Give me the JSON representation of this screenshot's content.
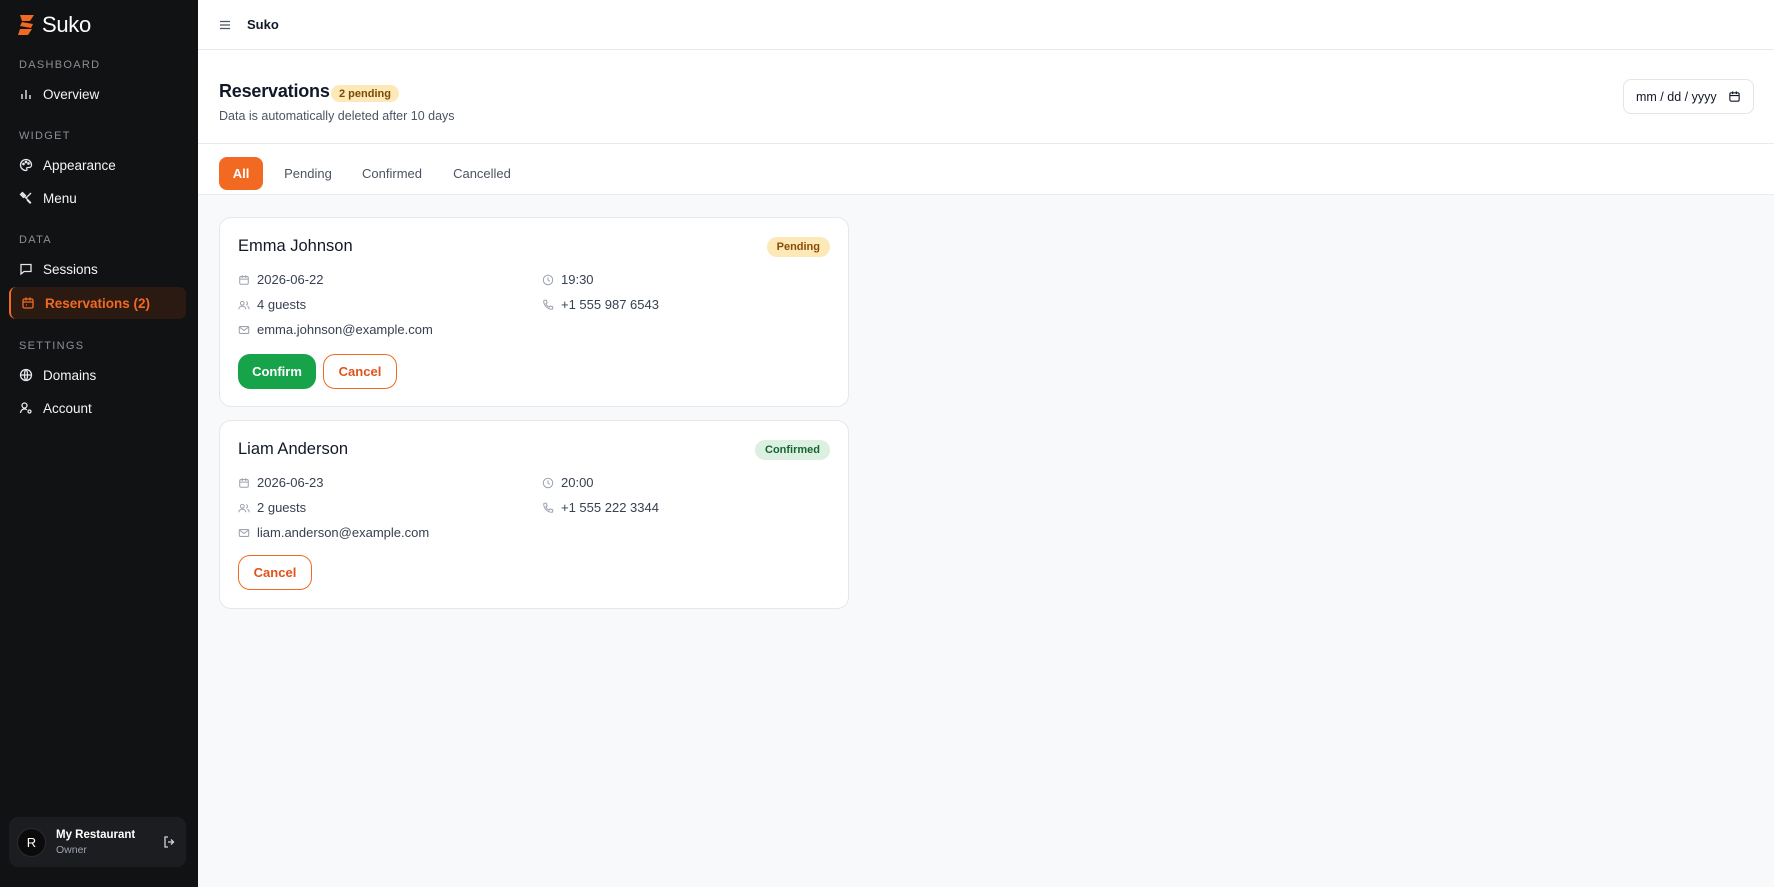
{
  "app": {
    "name": "Suko",
    "accent": "#f26a22"
  },
  "sidebar": {
    "sections": [
      {
        "label": "Dashboard"
      },
      {
        "label": "Widget"
      },
      {
        "label": "Data"
      },
      {
        "label": "Settings"
      }
    ],
    "items": [
      {
        "label": "Overview",
        "icon": "bar-chart-icon"
      },
      {
        "label": "Appearance",
        "icon": "palette-icon"
      },
      {
        "label": "Menu",
        "icon": "utensils-icon"
      },
      {
        "label": "Sessions",
        "icon": "message-icon"
      },
      {
        "label": "Reservations (2)",
        "icon": "calendar-icon",
        "active": true
      },
      {
        "label": "Domains",
        "icon": "globe-icon"
      },
      {
        "label": "Account",
        "icon": "user-cog-icon"
      }
    ],
    "user": {
      "initial": "R",
      "name": "My Restaurant",
      "role": "Owner"
    }
  },
  "topbar": {
    "title": "Suko"
  },
  "header": {
    "title": "Reservations",
    "pending_badge": "2 pending",
    "subtitle": "Data is automatically deleted after 10 days",
    "date_placeholder": "mm / dd / yyyy"
  },
  "tabs": [
    {
      "label": "All",
      "active": true
    },
    {
      "label": "Pending"
    },
    {
      "label": "Confirmed"
    },
    {
      "label": "Cancelled"
    }
  ],
  "reservations": [
    {
      "name": "Emma Johnson",
      "status": "Pending",
      "date": "2026-06-22",
      "time": "19:30",
      "guests": "4 guests",
      "phone": "+1 555 987 6543",
      "email": "emma.johnson@example.com",
      "confirm_label": "Confirm",
      "cancel_label": "Cancel"
    },
    {
      "name": "Liam Anderson",
      "status": "Confirmed",
      "date": "2026-06-23",
      "time": "20:00",
      "guests": "2 guests",
      "phone": "+1 555 222 3344",
      "email": "liam.anderson@example.com",
      "cancel_label": "Cancel"
    }
  ]
}
